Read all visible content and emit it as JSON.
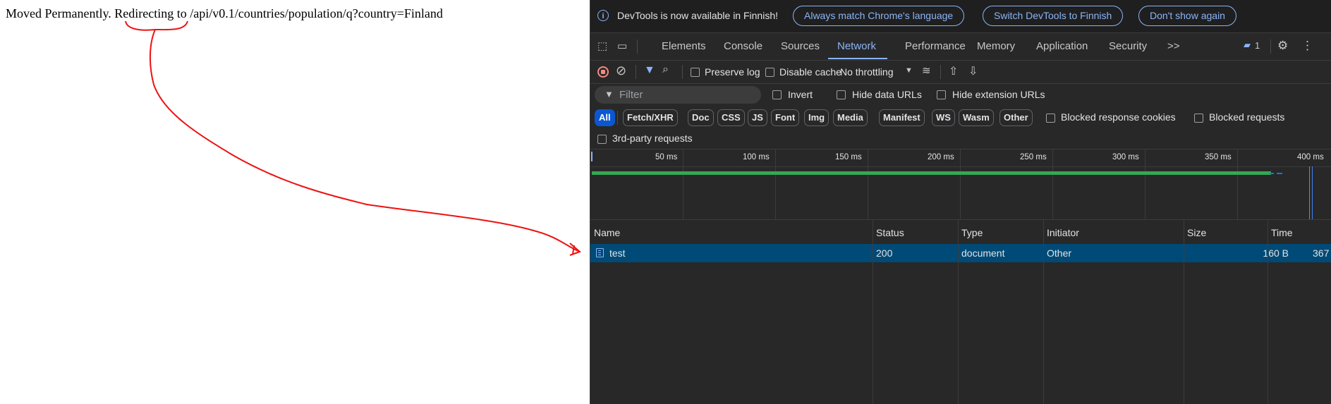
{
  "page": {
    "message": "Moved Permanently. Redirecting to /api/v0.1/countries/population/q?country=Finland"
  },
  "annotation": {
    "color": "#ee1111"
  },
  "devtools": {
    "infobar": {
      "icon": "info-icon",
      "text": "DevTools is now available in Finnish!",
      "buttons": [
        "Always match Chrome's language",
        "Switch DevTools to Finnish",
        "Don't show again"
      ]
    },
    "tabs": [
      "Elements",
      "Console",
      "Sources",
      "Network",
      "Performance",
      "Memory",
      "Application",
      "Security"
    ],
    "active_tab": "Network",
    "more_tabs": ">>",
    "issues_count": "1",
    "toolbar": {
      "preserve_log": "Preserve log",
      "disable_cache": "Disable cache",
      "throttling": "No throttling"
    },
    "filter": {
      "placeholder": "Filter",
      "invert": "Invert",
      "hide_data_urls": "Hide data URLs",
      "hide_extension_urls": "Hide extension URLs"
    },
    "type_filters": [
      "All",
      "Fetch/XHR",
      "Doc",
      "CSS",
      "JS",
      "Font",
      "Img",
      "Media",
      "Manifest",
      "WS",
      "Wasm",
      "Other"
    ],
    "active_type": "All",
    "blocked_response_cookies": "Blocked response cookies",
    "blocked_requests": "Blocked requests",
    "third_party": "3rd-party requests",
    "timeline": {
      "ticks": [
        "50 ms",
        "100 ms",
        "150 ms",
        "200 ms",
        "250 ms",
        "300 ms",
        "350 ms",
        "400 ms"
      ]
    },
    "table": {
      "columns": [
        "Name",
        "Status",
        "Type",
        "Initiator",
        "Size",
        "Time"
      ],
      "rows": [
        {
          "name": "test",
          "status": "200",
          "type": "document",
          "initiator": "Other",
          "size": "160 B",
          "time": "367"
        }
      ]
    },
    "colors": {
      "accent": "#8ab4f8",
      "selected_row": "#004a77",
      "timeline_bar": "#34a853"
    }
  }
}
